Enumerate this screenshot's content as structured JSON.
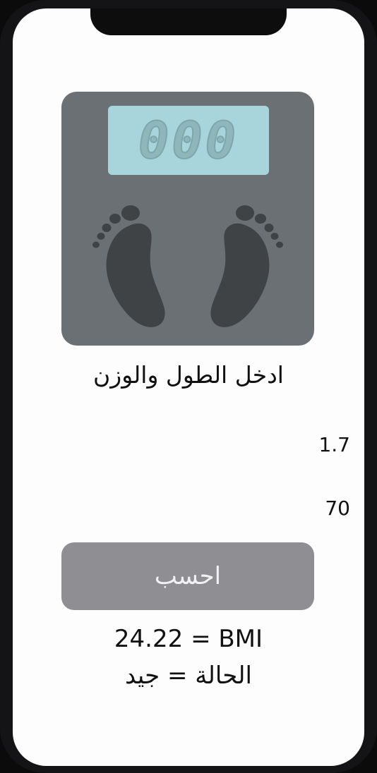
{
  "scale": {
    "display_value": "000",
    "icon": "bathroom-scale-feet-icon"
  },
  "prompt": "ادخل الطول والوزن",
  "inputs": {
    "height_value": "1.7",
    "weight_value": "70"
  },
  "calculate_button": "احسب",
  "result": {
    "bmi_line": "24.22 = BMI",
    "status_line": "الحالة = جيد"
  },
  "colors": {
    "scale_body": "#6b7075",
    "scale_display": "#a8d5dc",
    "button": "#8e8e93",
    "footprint": "#404345"
  }
}
